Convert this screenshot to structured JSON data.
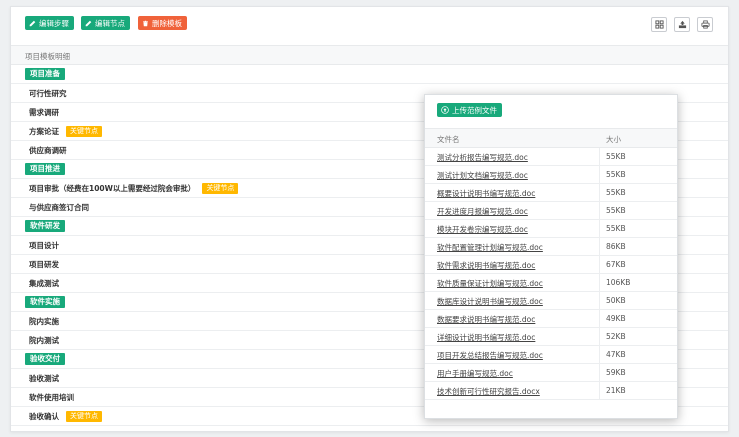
{
  "toolbar": {
    "edit_steps": "编辑步骤",
    "edit_nodes": "编辑节点",
    "delete_template": "删除模板"
  },
  "table": {
    "column_header": "项目模板明细",
    "key_node_label": "关键节点",
    "rows": [
      {
        "kind": "stage",
        "text": "项目准备"
      },
      {
        "kind": "step",
        "text": "可行性研究"
      },
      {
        "kind": "step",
        "text": "需求调研"
      },
      {
        "kind": "step",
        "text": "方案论证",
        "key": true
      },
      {
        "kind": "step",
        "text": "供应商调研"
      },
      {
        "kind": "stage",
        "text": "项目推进"
      },
      {
        "kind": "step",
        "text": "项目审批（经费在100W以上需要经过院会审批）",
        "key": true
      },
      {
        "kind": "step",
        "text": "与供应商签订合同"
      },
      {
        "kind": "stage",
        "text": "软件研发"
      },
      {
        "kind": "step",
        "text": "项目设计"
      },
      {
        "kind": "step",
        "text": "项目研发"
      },
      {
        "kind": "step",
        "text": "集成测试"
      },
      {
        "kind": "stage",
        "text": "软件实施"
      },
      {
        "kind": "step",
        "text": "院内实施"
      },
      {
        "kind": "step",
        "text": "院内测试"
      },
      {
        "kind": "stage",
        "text": "验收交付"
      },
      {
        "kind": "step",
        "text": "验收测试"
      },
      {
        "kind": "step",
        "text": "软件使用培训"
      },
      {
        "kind": "step",
        "text": "验收确认",
        "key": true
      }
    ]
  },
  "popup": {
    "upload_label": "上传范例文件",
    "header_name": "文件名",
    "header_size": "大小",
    "files": [
      {
        "name": "测试分析报告编写规范.doc",
        "size": "55KB"
      },
      {
        "name": "测试计划文档编写规范.doc",
        "size": "55KB"
      },
      {
        "name": "概要设计说明书编写规范.doc",
        "size": "55KB"
      },
      {
        "name": "开发进度月报编写规范.doc",
        "size": "55KB"
      },
      {
        "name": "模块开发卷宗编写规范.doc",
        "size": "55KB"
      },
      {
        "name": "软件配置管理计划编写规范.doc",
        "size": "86KB"
      },
      {
        "name": "软件需求说明书编写规范.doc",
        "size": "67KB"
      },
      {
        "name": "软件质量保证计划编写规范.doc",
        "size": "106KB"
      },
      {
        "name": "数据库设计说明书编写规范.doc",
        "size": "50KB"
      },
      {
        "name": "数据要求说明书编写规范.doc",
        "size": "49KB"
      },
      {
        "name": "详细设计说明书编写规范.doc",
        "size": "52KB"
      },
      {
        "name": "项目开发总结报告编写规范.doc",
        "size": "47KB"
      },
      {
        "name": "用户手册编写规范.doc",
        "size": "59KB"
      },
      {
        "name": "技术创新可行性研究报告.docx",
        "size": "21KB"
      }
    ]
  },
  "icons": {
    "edit": "pencil-icon",
    "delete": "trash-icon",
    "grid": "grid-icon",
    "export": "export-icon",
    "print": "print-icon",
    "upload": "cloud-upload-icon"
  },
  "colors": {
    "primary": "#18a97b",
    "danger": "#f0623a",
    "key_badge": "#ffb800"
  }
}
